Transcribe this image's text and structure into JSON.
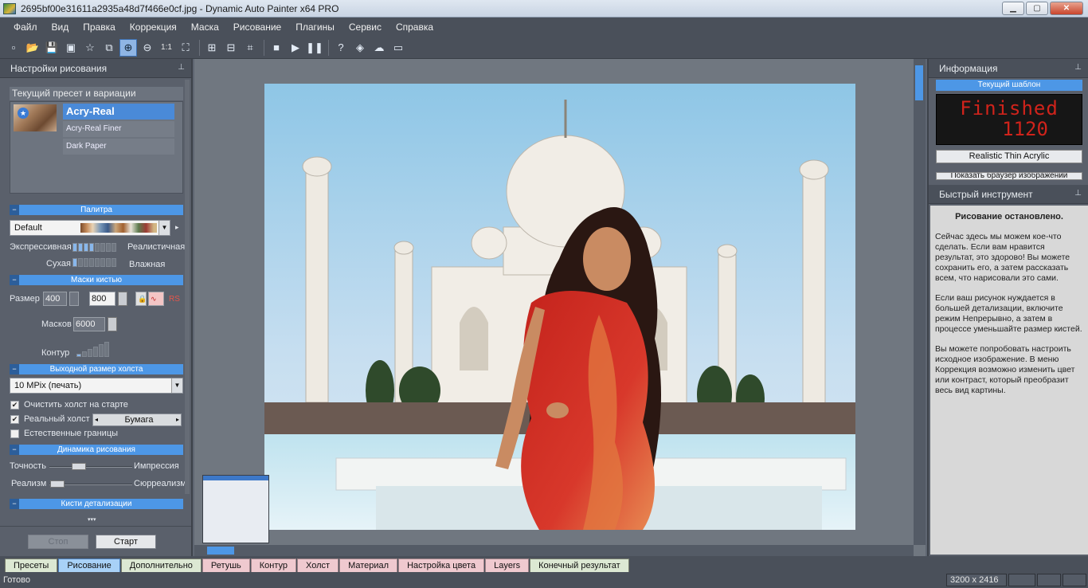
{
  "window": {
    "title": "2695bf00e31611a2935a48d7f466e0cf.jpg - Dynamic Auto Painter x64 PRO",
    "minimize": "▁",
    "maximize": "▢",
    "close": "✕"
  },
  "menu": [
    "Файл",
    "Вид",
    "Правка",
    "Коррекция",
    "Маска",
    "Рисование",
    "Плагины",
    "Сервис",
    "Справка"
  ],
  "toolbar": {
    "zoom_label": "1:1"
  },
  "left_panel": {
    "title": "Настройки рисования",
    "preset_header": "Текущий пресет и вариации",
    "presets": [
      "Acry-Real",
      "Acry-Real Finer",
      "Dark Paper"
    ],
    "palette_section": "Палитра",
    "palette_value": "Default",
    "expressive_label": "Экспрессивная",
    "realistic_label": "Реалистичная",
    "dry_label": "Сухая",
    "wet_label": "Влажная",
    "brush_masks_section": "Маски кистью",
    "size_label": "Размер",
    "size_min": "400",
    "size_max": "800",
    "rs_label": "RS",
    "masks_label": "Масков",
    "masks_value": "6000",
    "contour_label": "Контур",
    "canvas_size_section": "Выходной размер холста",
    "canvas_size_value": "10 MPix (печать)",
    "clear_canvas_label": "Очистить холст на старте",
    "real_canvas_label": "Реальный холст",
    "real_canvas_value": "Бумага",
    "natural_borders_label": "Естественные границы",
    "dynamics_section": "Динамика рисования",
    "precision_label": "Точность",
    "impression_label": "Импрессия",
    "realism_label": "Реализм",
    "surrealism_label": "Сюрреализм",
    "detail_brushes_section": "Кисти детализации",
    "stop_button": "Стоп",
    "start_button": "Старт"
  },
  "right_panel": {
    "info_title": "Информация",
    "current_template_label": "Текущий шаблон",
    "led_status": "Finished",
    "led_count": "1120",
    "template_name": "Realistic Thin Acrylic",
    "browser_button": "Показать браузер изображений",
    "quick_title": "Быстрый инструмент",
    "quick_heading": "Рисование остановлено.",
    "quick_p1": "Сейчас здесь мы можем кое-что сделать. Если вам нравится результат, это здорово! Вы можете сохранить его, а затем рассказать всем, что нарисовали это сами.",
    "quick_p2": "Если ваш рисунок нуждается в большей детализации, включите режим Непрерывно, а затем в процессе уменьшайте размер кистей.",
    "quick_p3": "Вы можете попробовать настроить исходное изображение. В меню Коррекция возможно изменить цвет или контраст, который преобразит весь вид картины."
  },
  "tabs": [
    "Пресеты",
    "Рисование",
    "Дополнительно",
    "Ретушь",
    "Контур",
    "Холст",
    "Материал",
    "Настройка цвета",
    "Layers",
    "Конечный результат"
  ],
  "status": {
    "text": "Готово",
    "dimensions": "3200 x 2416"
  },
  "colors": {
    "accent": "#4d97e6",
    "panel_bg": "#5a606b",
    "led_red": "#d0231b"
  }
}
